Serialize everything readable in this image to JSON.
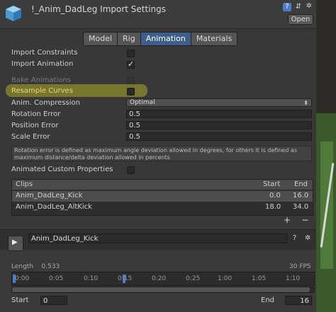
{
  "header": {
    "title": "!_Anim_DadLeg Import Settings",
    "open_label": "Open",
    "icons": [
      "help-icon",
      "slider-icon",
      "gear-icon"
    ],
    "help_glyph": "?",
    "slider_glyph": "⇵",
    "gear_glyph": "✲"
  },
  "tabs": [
    {
      "label": "Model",
      "active": false
    },
    {
      "label": "Rig",
      "active": false
    },
    {
      "label": "Animation",
      "active": true
    },
    {
      "label": "Materials",
      "active": false
    }
  ],
  "settings": {
    "import_constraints": {
      "label": "Import Constraints",
      "checked": false
    },
    "import_animation": {
      "label": "Import Animation",
      "checked": true
    },
    "bake_animations": {
      "label": "Bake Animations",
      "checked": false,
      "disabled": true
    },
    "resample_curves": {
      "label": "Resample Curves",
      "checked": false
    },
    "anim_compression": {
      "label": "Anim. Compression",
      "value": "Optimal"
    },
    "rotation_error": {
      "label": "Rotation Error",
      "value": "0.5"
    },
    "position_error": {
      "label": "Position Error",
      "value": "0.5"
    },
    "scale_error": {
      "label": "Scale Error",
      "value": "0.5"
    },
    "info_text": "Rotation error is defined as maximum angle deviation allowed in degrees, for others it is defined as maximum distance/delta deviation allowed in percents",
    "animated_custom_properties": {
      "label": "Animated Custom Properties",
      "checked": false
    }
  },
  "clips": {
    "headers": {
      "name": "Clips",
      "start": "Start",
      "end": "End"
    },
    "rows": [
      {
        "name": "Anim_DadLeg_Kick",
        "start": "0.0",
        "end": "16.0",
        "selected": true
      },
      {
        "name": "Anim_DadLeg_AltKick",
        "start": "18.0",
        "end": "34.0",
        "selected": false
      }
    ],
    "add_label": "+",
    "remove_label": "−"
  },
  "preview": {
    "clip_name": "Anim_DadLeg_Kick",
    "length_label": "Length",
    "length_value": "0.533",
    "fps": "30 FPS",
    "ruler_labels": [
      "0:00",
      "0:05",
      "0:10",
      "0:15",
      "0:20",
      "0:25",
      "1:00",
      "1:05",
      "1:10"
    ],
    "start_label": "Start",
    "start_value": "0",
    "end_label": "End",
    "end_value": "16"
  },
  "colors": {
    "active_tab": "#3e5f8a",
    "highlight": "#aaaa28",
    "help_icon": "#4d7bc7"
  }
}
